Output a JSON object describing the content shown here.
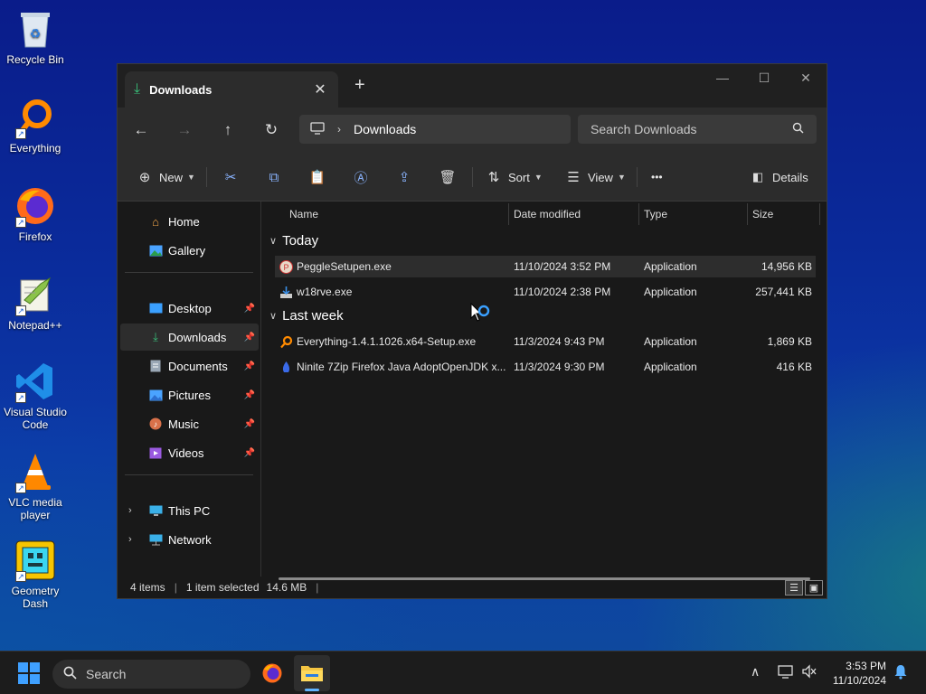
{
  "desktop": {
    "icons": [
      {
        "label": "Recycle Bin",
        "icon": "recycle-bin-icon"
      },
      {
        "label": "Everything",
        "icon": "everything-icon"
      },
      {
        "label": "Firefox",
        "icon": "firefox-icon"
      },
      {
        "label": "Notepad++",
        "icon": "notepad-plus-plus-icon"
      },
      {
        "label": "Visual Studio Code",
        "icon": "vscode-icon"
      },
      {
        "label": "VLC media player",
        "icon": "vlc-icon"
      },
      {
        "label": "Geometry Dash",
        "icon": "geometry-dash-icon"
      }
    ]
  },
  "window": {
    "tab_title": "Downloads",
    "address": {
      "crumb": "Downloads"
    },
    "search": {
      "placeholder": "Search Downloads"
    },
    "toolbar": {
      "new_label": "New",
      "sort_label": "Sort",
      "view_label": "View",
      "details_label": "Details",
      "more_label": "•••"
    },
    "sidebar": {
      "items": [
        {
          "label": "Home"
        },
        {
          "label": "Gallery"
        },
        {
          "label": "Desktop"
        },
        {
          "label": "Downloads"
        },
        {
          "label": "Documents"
        },
        {
          "label": "Pictures"
        },
        {
          "label": "Music"
        },
        {
          "label": "Videos"
        },
        {
          "label": "This PC"
        },
        {
          "label": "Network"
        }
      ]
    },
    "columns": {
      "name": "Name",
      "date": "Date modified",
      "type": "Type",
      "size": "Size"
    },
    "groups": [
      {
        "label": "Today",
        "files": [
          {
            "name": "PeggleSetupen.exe",
            "date": "11/10/2024 3:52 PM",
            "type": "Application",
            "size": "14,956 KB"
          },
          {
            "name": "w18rve.exe",
            "date": "11/10/2024 2:38 PM",
            "type": "Application",
            "size": "257,441 KB"
          }
        ]
      },
      {
        "label": "Last week",
        "files": [
          {
            "name": "Everything-1.4.1.1026.x64-Setup.exe",
            "date": "11/3/2024 9:43 PM",
            "type": "Application",
            "size": "1,869 KB"
          },
          {
            "name": "Ninite 7Zip Firefox Java AdoptOpenJDK x...",
            "date": "11/3/2024 9:30 PM",
            "type": "Application",
            "size": "416 KB"
          }
        ]
      }
    ],
    "status": {
      "items": "4 items",
      "selected": "1 item selected",
      "size": "14.6 MB"
    }
  },
  "taskbar": {
    "search_label": "Search",
    "time": "3:53 PM",
    "date": "11/10/2024"
  },
  "colors": {
    "accent": "#3fa0ff",
    "window_bg": "#191919",
    "chrome_bg": "#2c2c2c"
  }
}
